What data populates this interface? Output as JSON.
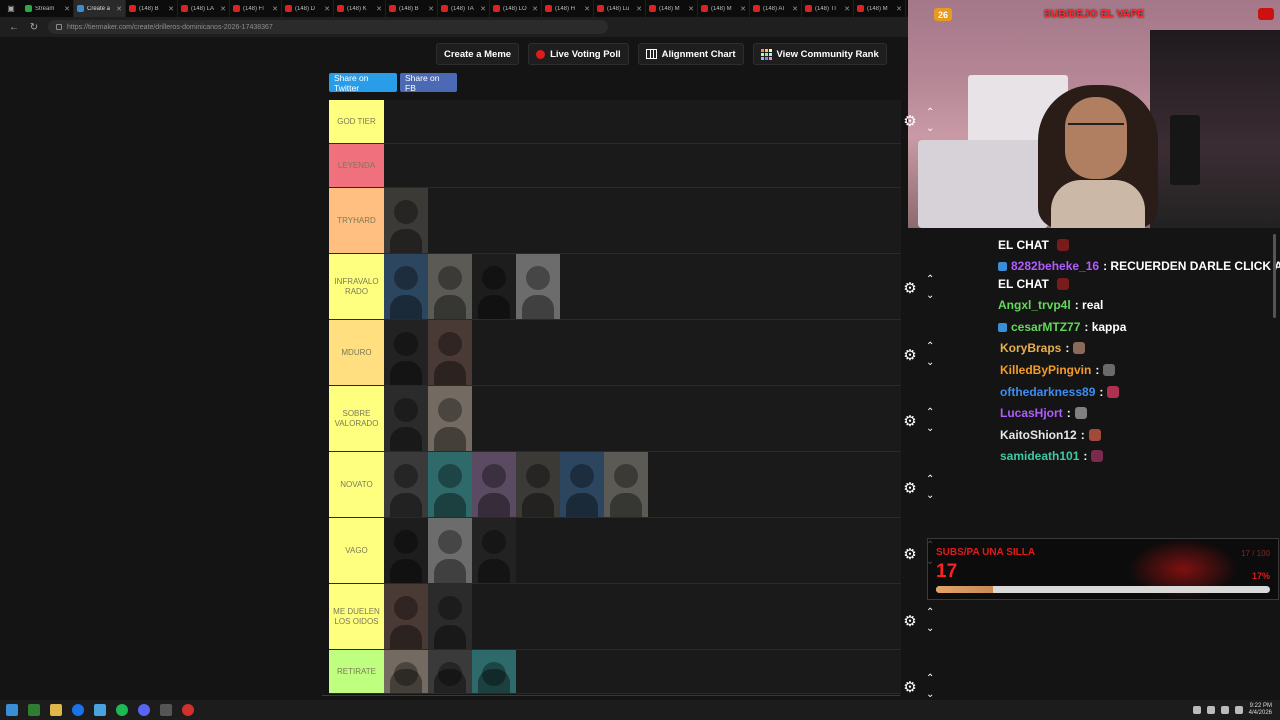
{
  "browser": {
    "tabs": [
      {
        "label": "Stream",
        "fav": "s"
      },
      {
        "label": "Create a",
        "fav": "c",
        "active": true
      },
      {
        "label": "(148) B",
        "fav": "y"
      },
      {
        "label": "(148) LA",
        "fav": "y"
      },
      {
        "label": "(148) Fl",
        "fav": "y"
      },
      {
        "label": "(148) D",
        "fav": "y"
      },
      {
        "label": "(148) K",
        "fav": "y"
      },
      {
        "label": "(148) B",
        "fav": "y"
      },
      {
        "label": "(148) TA",
        "fav": "y"
      },
      {
        "label": "(148) LO",
        "fav": "y"
      },
      {
        "label": "(148) H",
        "fav": "y"
      },
      {
        "label": "(148) Lu",
        "fav": "y"
      },
      {
        "label": "(148) M",
        "fav": "y"
      },
      {
        "label": "(148) M",
        "fav": "y"
      },
      {
        "label": "(148) AT",
        "fav": "y"
      },
      {
        "label": "(148) TI",
        "fav": "y"
      },
      {
        "label": "(148) M",
        "fav": "y"
      }
    ],
    "url": "https://tiermaker.com/create/drilleros-dominicanos-2026-17438367"
  },
  "toolbar": {
    "create_meme": "Create a Meme",
    "live_voting": "Live Voting Poll",
    "alignment_chart": "Alignment Chart",
    "community_rank": "View Community Rank"
  },
  "share": {
    "twitter": "Share on Twitter",
    "facebook": "Share on FB"
  },
  "tiers": [
    {
      "label": "GOD TIER",
      "color": "#ffff7f",
      "count": 0
    },
    {
      "label": "LEYENDA",
      "color": "#f1707e",
      "count": 0
    },
    {
      "label": "TRYHARD",
      "color": "#ffbf80",
      "count": 1
    },
    {
      "label": "INFRAVALO RADO",
      "color": "#ffff7f",
      "count": 4
    },
    {
      "label": "MDURO",
      "color": "#ffdf80",
      "count": 2
    },
    {
      "label": "SOBRE VALORADO",
      "color": "#ffff7f",
      "count": 2
    },
    {
      "label": "NOVATO",
      "color": "#ffff7f",
      "count": 6
    },
    {
      "label": "VAGO",
      "color": "#ffff7f",
      "count": 3
    },
    {
      "label": "ME DUELEN LOS OIDOS",
      "color": "#ffff7f",
      "count": 2
    },
    {
      "label": "RETIRATE",
      "color": "#bfff7f",
      "count": 3
    }
  ],
  "overlay": {
    "sub_count": "26",
    "title": "SUB/DEJO EL VAPE"
  },
  "chat": [
    {
      "user": "EL CHAT",
      "color": "#ffffff",
      "text": ""
    },
    {
      "user": "8282beheke_16",
      "color": "#b05cff",
      "text": ": RECUERDEN DARLE CLICK A"
    },
    {
      "user": "EL CHAT",
      "color": "#ffffff",
      "text": ""
    },
    {
      "user": "Angxl_trvp4l",
      "color": "#62d95a",
      "text": ": real"
    },
    {
      "user": "cesarMTZ77",
      "color": "#62d95a",
      "text": ": kappa"
    },
    {
      "user": "KoryBraps",
      "color": "#e8b04d",
      "text": ":"
    },
    {
      "user": "KilledByPingvin",
      "color": "#f59b27",
      "text": ":"
    },
    {
      "user": "ofthedarkness89",
      "color": "#3e8df0",
      "text": ":"
    },
    {
      "user": "LucasHjort",
      "color": "#b05cff",
      "text": ":"
    },
    {
      "user": "KaitoShion12",
      "color": "#e6e6e6",
      "text": ":"
    },
    {
      "user": "samideath101",
      "color": "#3cc9a3",
      "text": ":"
    }
  ],
  "goal": {
    "title": "SUBS/PA UNA SILLA",
    "count": "17",
    "percent_label": "17%",
    "target": "17 / 100",
    "progress": 0.17
  },
  "taskbar": {
    "time": "9:22 PM",
    "date": "4/4/2026"
  }
}
